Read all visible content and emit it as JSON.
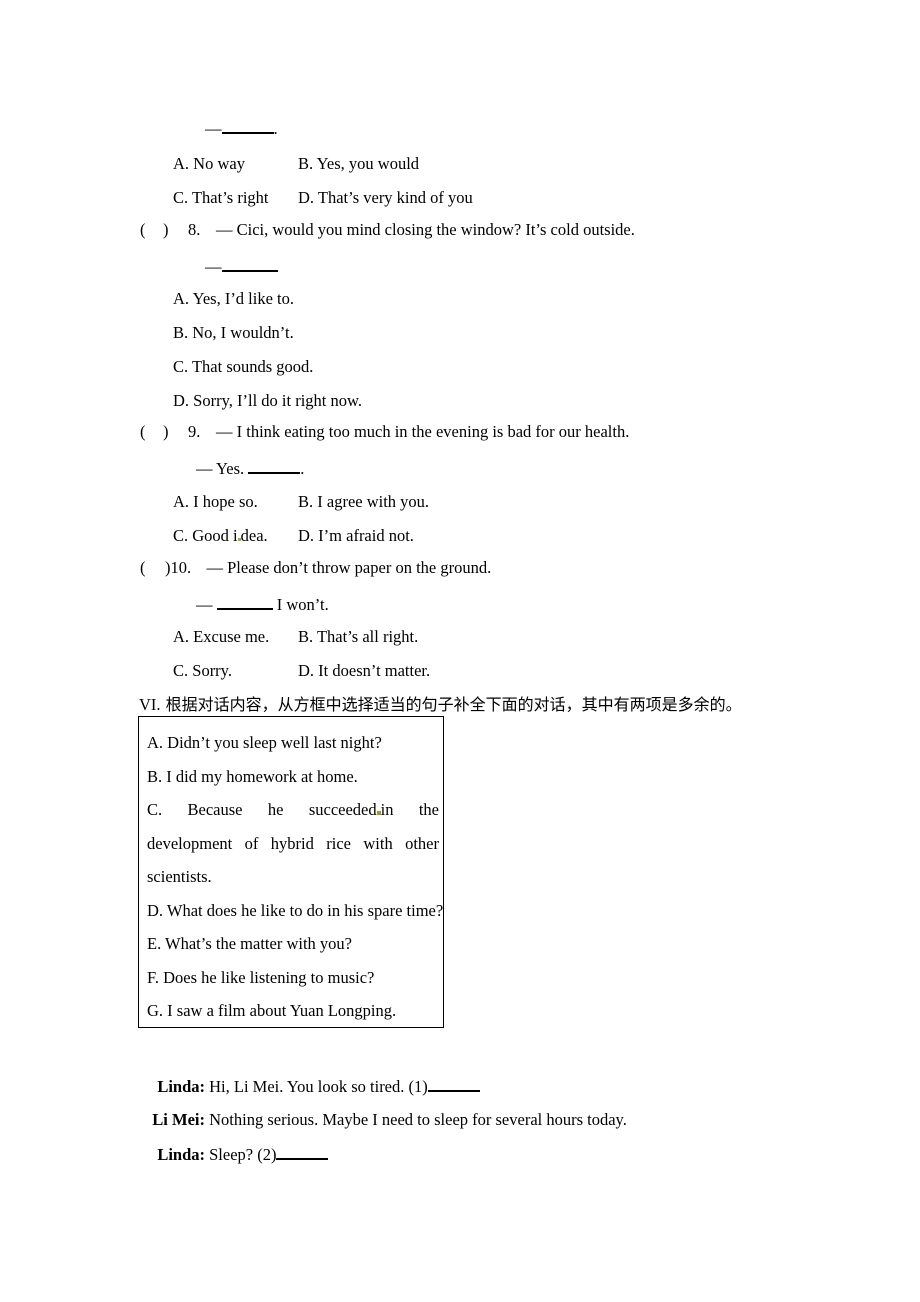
{
  "document": {
    "type": "english-exam-worksheet-page"
  },
  "question7_tail": {
    "answer_line_dash": "—",
    "answer_line_period": ".",
    "options": [
      {
        "key": "A.",
        "text": "No way"
      },
      {
        "key": "B.",
        "text": "Yes, you would"
      },
      {
        "key": "C.",
        "text": "That’s right"
      },
      {
        "key": "D.",
        "text": "That’s very kind of you"
      }
    ]
  },
  "question8": {
    "paren_open": "(",
    "paren_close": ")",
    "number": "8.",
    "stem": "— Cici, would you mind closing the window? It’s cold outside.",
    "answer_line_dash": "—",
    "options": [
      {
        "key": "A.",
        "text": "Yes, I’d like to."
      },
      {
        "key": "B.",
        "text": "No, I wouldn’t."
      },
      {
        "key": "C.",
        "text": "That sounds good."
      },
      {
        "key": "D.",
        "text": "Sorry, I’ll do it right now."
      }
    ]
  },
  "question9": {
    "paren_open": "(",
    "paren_close": ")",
    "number": "9.",
    "stem": "— I think eating too much in the evening is bad for our health.",
    "answer_line_prefix": "— Yes.",
    "answer_line_period": ".",
    "options": [
      {
        "key": "A.",
        "text": "I hope so."
      },
      {
        "key": "B.",
        "text": "I agree with you."
      },
      {
        "key": "C.",
        "text": "Good i"
      },
      {
        "key": "C_tail",
        "text": "dea."
      },
      {
        "key": "D.",
        "text": "I’m afraid not."
      }
    ]
  },
  "question10": {
    "paren_open": "(",
    "paren_close": ")",
    "number": "10.",
    "stem": "— Please don’t throw paper on the ground.",
    "answer_line_dash": "—",
    "answer_line_suffix": "I won’t.",
    "options": [
      {
        "key": "A.",
        "text": "Excuse me."
      },
      {
        "key": "B.",
        "text": "That’s all right."
      },
      {
        "key": "C.",
        "text": "Sorry."
      },
      {
        "key": "D.",
        "text": "It doesn’t matter."
      }
    ]
  },
  "section6": {
    "roman": "VI.",
    "instruction": "根据对话内容，从方框中选择适当的句子补全下面的对话，其中有两项是多余的。",
    "box_options": {
      "a": "A. Didn’t you sleep well last night?",
      "b": "B. I did my homework at home.",
      "c_line1": "C.  Because  he  succeeded",
      "c_line1_tail": "in  the",
      "c_line2": "development  of  hybrid  rice  with  other",
      "c_line3": "scientists.",
      "d": "D. What does he like to do in his spare time?",
      "e": "E. What’s the matter with you?",
      "f": "F. Does he like listening to music?",
      "g": "G. I saw a film about Yuan Longping."
    }
  },
  "dialogue": {
    "lines": [
      {
        "who": "Linda:",
        "text": "Hi, Li Mei. You look so tired. (1)",
        "blank": true
      },
      {
        "who": "Li Mei:",
        "text": "Nothing serious. Maybe I need to sleep for several hours today.",
        "blank": false
      },
      {
        "who": "Linda:",
        "text": "Sleep? (2)",
        "blank": true
      }
    ]
  }
}
